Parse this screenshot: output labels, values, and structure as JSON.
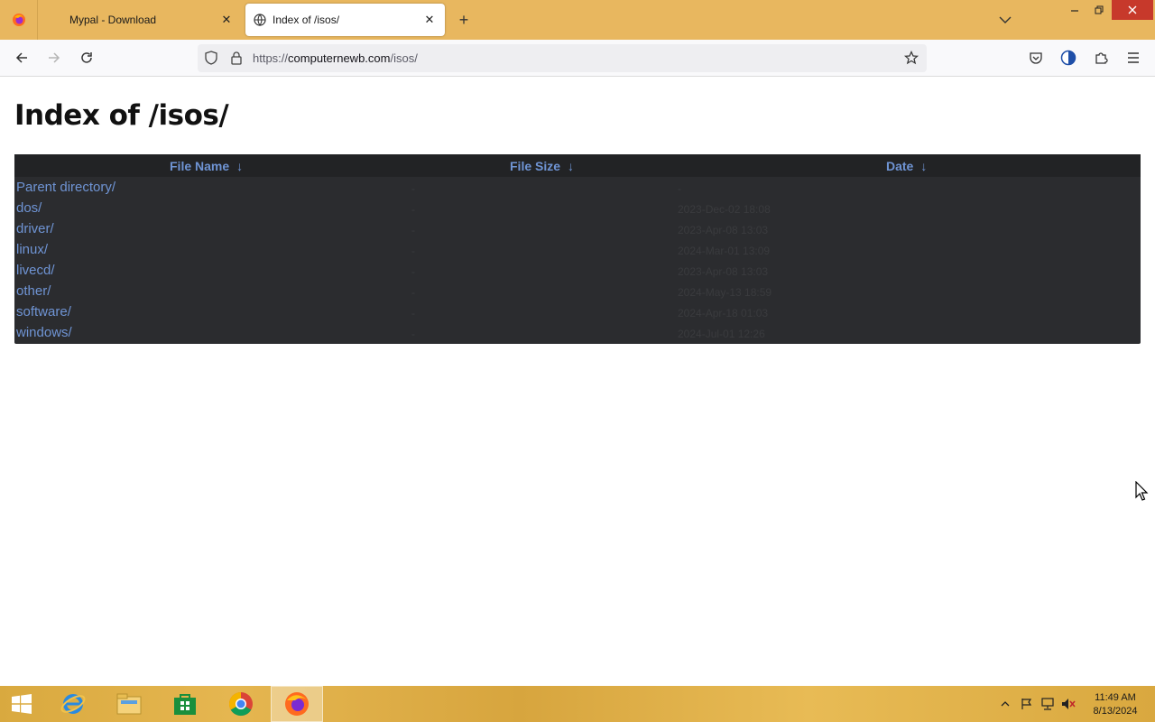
{
  "browser": {
    "tabs": [
      {
        "label": "Mypal - Download",
        "active": false
      },
      {
        "label": "Index of /isos/",
        "active": true
      }
    ],
    "url": {
      "scheme": "https://",
      "host": "computernewb.com",
      "path": "/isos/"
    }
  },
  "page": {
    "title": "Index of /isos/",
    "columns": {
      "name": "File Name",
      "size": "File Size",
      "date": "Date",
      "sort_arrow": "↓"
    },
    "rows": [
      {
        "name": "Parent directory/",
        "size": "-",
        "date": "-"
      },
      {
        "name": "dos/",
        "size": "-",
        "date": "2023-Dec-02 18:08"
      },
      {
        "name": "driver/",
        "size": "-",
        "date": "2023-Apr-08 13:03"
      },
      {
        "name": "linux/",
        "size": "-",
        "date": "2024-Mar-01 13:09"
      },
      {
        "name": "livecd/",
        "size": "-",
        "date": "2023-Apr-08 13:03"
      },
      {
        "name": "other/",
        "size": "-",
        "date": "2024-May-13 18:59"
      },
      {
        "name": "software/",
        "size": "-",
        "date": "2024-Apr-18 01:03"
      },
      {
        "name": "windows/",
        "size": "-",
        "date": "2024-Jul-01 12:26"
      }
    ]
  },
  "taskbar": {
    "apps": [
      "start-icon",
      "internet-explorer-icon",
      "file-explorer-icon",
      "store-icon",
      "chrome-icon",
      "firefox-icon"
    ],
    "clock": {
      "time": "11:49 AM",
      "date": "8/13/2024"
    }
  },
  "colors": {
    "titlebar": "#e8b75f",
    "link": "#6f94d4",
    "table_bg": "#2b2c2f",
    "close": "#c7392b"
  }
}
